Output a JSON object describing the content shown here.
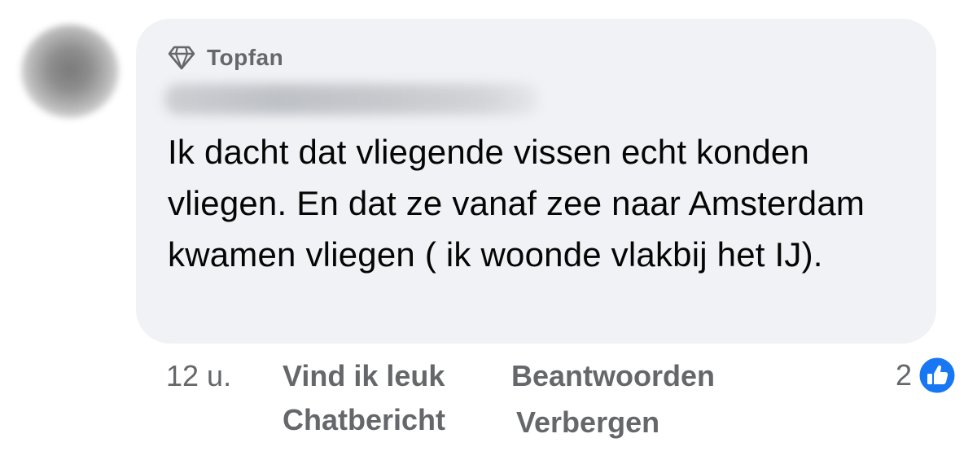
{
  "comment": {
    "badge": {
      "label": "Topfan",
      "icon": "diamond-icon"
    },
    "text": "Ik dacht dat vliegende vissen echt konden vliegen. En dat ze vanaf zee naar Amsterdam kwamen vliegen ( ik woonde vlakbij het IJ)."
  },
  "actions": {
    "timestamp": "12 u.",
    "like": "Vind ik leuk",
    "reply": "Beantwoorden",
    "message": "Chatbericht",
    "hide": "Verbergen"
  },
  "reactions": {
    "count": "2",
    "icon": "like-icon",
    "color": "#1877f2"
  },
  "colors": {
    "bubble": "#f0f2f5",
    "secondary_text": "#65676b",
    "primary_text": "#050505"
  }
}
